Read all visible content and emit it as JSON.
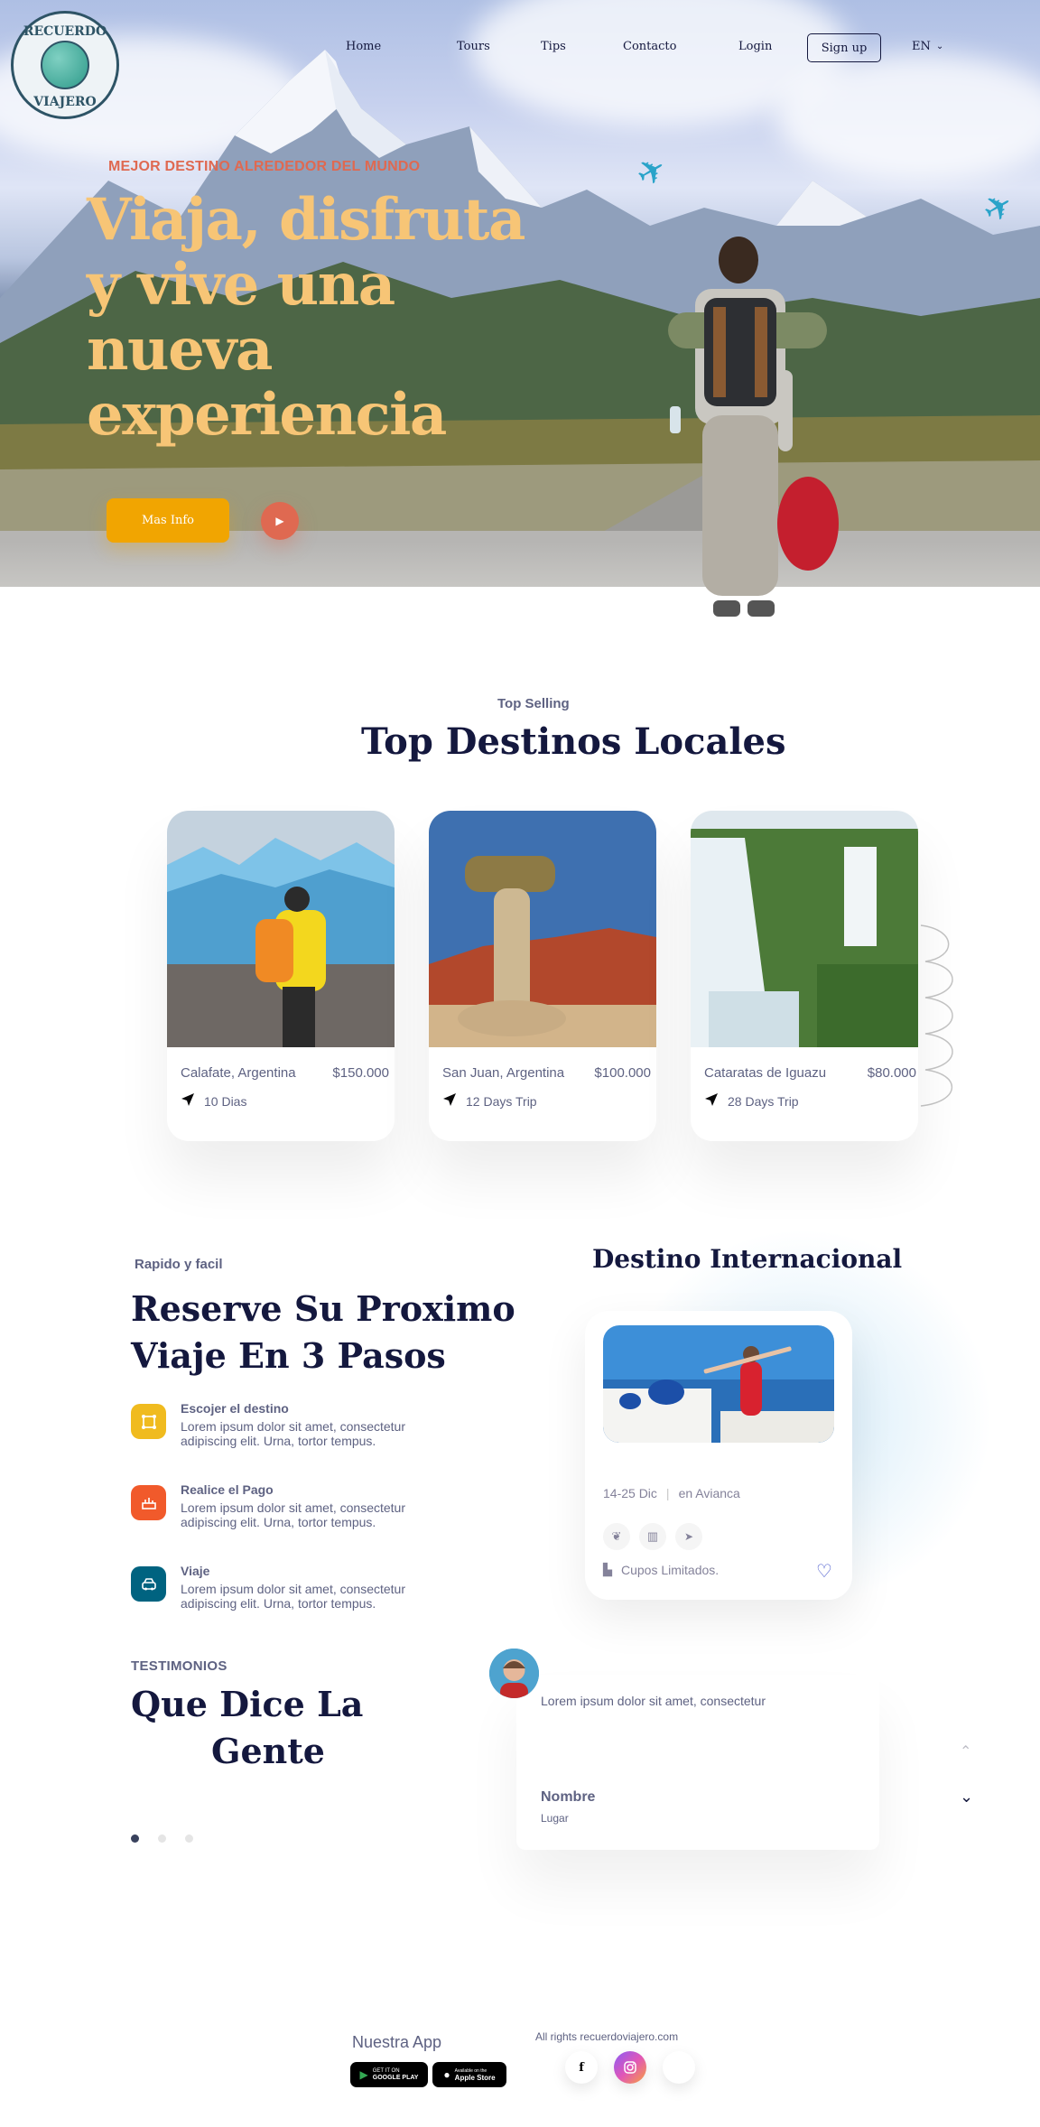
{
  "brand": {
    "logo_top": "RECUERDO",
    "logo_bottom": "VIAJERO"
  },
  "nav": {
    "items": [
      {
        "label": "Home"
      },
      {
        "label": "Tours"
      },
      {
        "label": "Tips"
      },
      {
        "label": "Contacto"
      },
      {
        "label": "Login"
      }
    ],
    "signup_label": "Sign up",
    "language": "EN"
  },
  "hero": {
    "eyebrow": "MEJOR DESTINO ALREDEDOR DEL MUNDO",
    "headline_line1": "Viaja, disfruta",
    "headline_line2": "y vive una nueva",
    "headline_line3": "experiencia",
    "cta_label": "Mas Info"
  },
  "top_destinations": {
    "subtitle": "Top Selling",
    "title": "Top Destinos Locales",
    "cards": [
      {
        "name": "Calafate, Argentina",
        "price": "$150.000",
        "days": "10 Dias"
      },
      {
        "name": "San Juan, Argentina",
        "price": "$100.000",
        "days": "12 Days Trip"
      },
      {
        "name": "Cataratas de Iguazu",
        "price": "$80.000",
        "days": "28 Days Trip"
      }
    ]
  },
  "steps": {
    "subtitle": "Rapido y facil",
    "title_line1": "Reserve Su Proximo",
    "title_line2": "Viaje En 3 Pasos",
    "items": [
      {
        "title": "Escojer el destino",
        "desc_line1": "Lorem ipsum dolor sit amet, consectetur",
        "desc_line2": "adipiscing elit. Urna, tortor tempus.",
        "color": "#f0bb1f"
      },
      {
        "title": "Realice el Pago",
        "desc_line1": "Lorem ipsum dolor sit amet, consectetur",
        "desc_line2": "adipiscing elit. Urna, tortor tempus.",
        "color": "#f15a2b"
      },
      {
        "title": "Viaje",
        "desc_line1": "Lorem ipsum dolor sit amet, consectetur",
        "desc_line2": "adipiscing elit. Urna, tortor tempus.",
        "color": "#006380"
      }
    ]
  },
  "international": {
    "title": "Destino Internacional",
    "dates": "14-25 Dic",
    "airline": "en Avianca",
    "availability": "Cupos Limitados."
  },
  "testimonials": {
    "eyebrow": "TESTIMONIOS",
    "title_line1": "Que Dice La",
    "title_line2": "Gente",
    "quote": "Lorem ipsum dolor sit amet, consectetur",
    "name": "Nombre",
    "place": "Lugar"
  },
  "footer": {
    "app_title": "Nuestra App",
    "google_small": "GET IT ON",
    "google_big": "GOOGLE PLAY",
    "apple_small": "Available on the",
    "apple_big": "Apple Store",
    "rights": "All rights recuerdoviajero.com",
    "facebook_glyph": "f"
  },
  "colors": {
    "accent_yellow": "#f1a501",
    "accent_orange": "#df6951",
    "headline": "#f7c576",
    "navy": "#14183e",
    "muted": "#5e6282"
  }
}
